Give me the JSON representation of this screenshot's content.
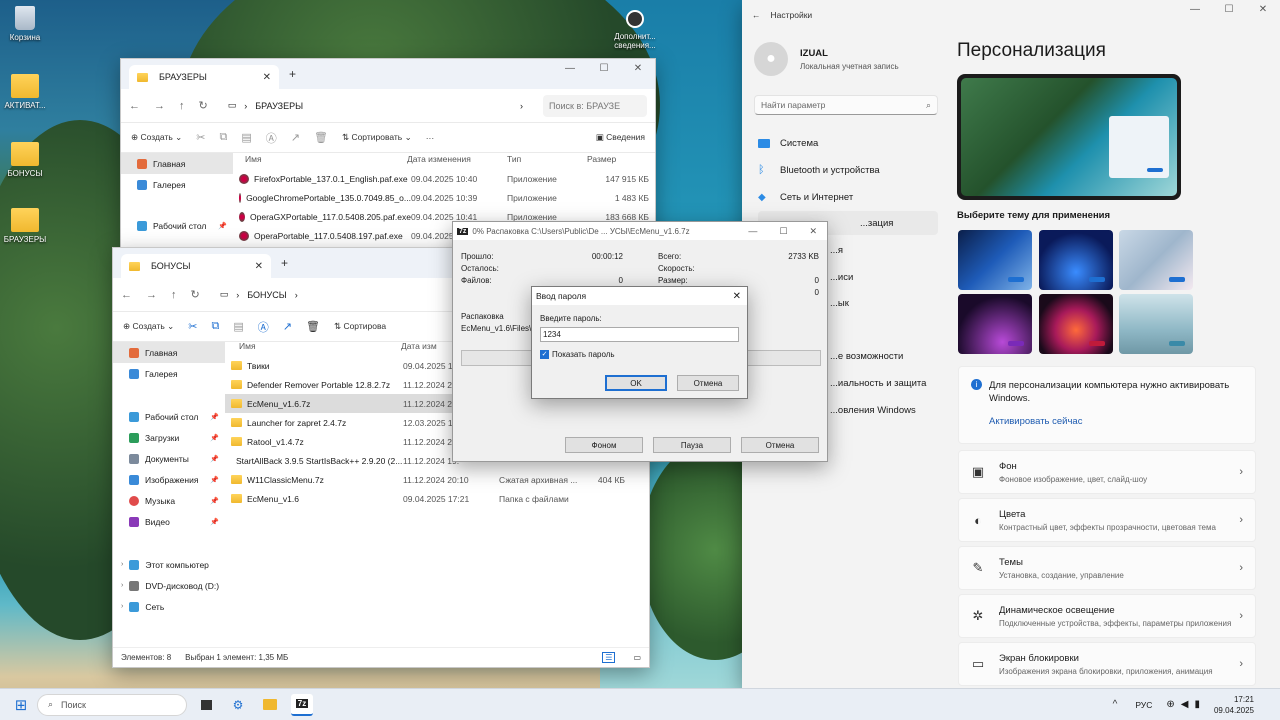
{
  "desktop": {
    "icons": [
      {
        "label": "Корзина"
      },
      {
        "label": "АКТИВАТ..."
      },
      {
        "label": "БОНУСЫ"
      },
      {
        "label": "БРАУЗЕРЫ"
      }
    ],
    "activation_widget": "Дополнит... сведения..."
  },
  "explorer_browsers": {
    "tab_title": "БРАУЗЕРЫ",
    "breadcrumb": "БРАУЗЕРЫ",
    "search_placeholder": "Поиск в: БРАУЗЕ",
    "toolbar": {
      "create": "Создать",
      "sort": "Сортировать",
      "details": "Сведения"
    },
    "nav": [
      {
        "label": "Главная"
      },
      {
        "label": "Галерея"
      },
      {
        "label": "Рабочий стол"
      }
    ],
    "columns": {
      "name": "Имя",
      "date": "Дата изменения",
      "type": "Тип",
      "size": "Размер"
    },
    "rows": [
      {
        "name": "FirefoxPortable_137.0.1_English.paf.exe",
        "date": "09.04.2025 10:40",
        "type": "Приложение",
        "size": "147 915 КБ"
      },
      {
        "name": "GoogleChromePortable_135.0.7049.85_o...",
        "date": "09.04.2025 10:39",
        "type": "Приложение",
        "size": "1 483 КБ"
      },
      {
        "name": "OperaGXPortable_117.0.5408.205.paf.exe",
        "date": "09.04.2025 10:41",
        "type": "Приложение",
        "size": "183 668 КБ"
      },
      {
        "name": "OperaPortable_117.0.5408.197.paf.exe",
        "date": "09.04.2025 10:",
        "type": "Приложение",
        "size": ""
      }
    ]
  },
  "explorer_bonus": {
    "tab_title": "БОНУСЫ",
    "breadcrumb": "БОНУСЫ",
    "toolbar": {
      "create": "Создать",
      "sort": "Сортирова"
    },
    "nav": [
      {
        "label": "Главная"
      },
      {
        "label": "Галерея"
      },
      {
        "label": "Рабочий стол"
      },
      {
        "label": "Загрузки"
      },
      {
        "label": "Документы"
      },
      {
        "label": "Изображения"
      },
      {
        "label": "Музыка"
      },
      {
        "label": "Видео"
      },
      {
        "label": "Этот компьютер"
      },
      {
        "label": "DVD-дисковод (D:)"
      },
      {
        "label": "Сеть"
      }
    ],
    "columns": {
      "name": "Имя",
      "date": "Дата изм"
    },
    "rows": [
      {
        "name": "Твики",
        "date": "09.04.2025 12:",
        "type": "",
        "size": ""
      },
      {
        "name": "Defender Remover Portable 12.8.2.7z",
        "date": "11.12.2024 20:",
        "type": "",
        "size": ""
      },
      {
        "name": "EcMenu_v1.6.7z",
        "date": "11.12.2024 20:",
        "type": "",
        "size": ""
      },
      {
        "name": "Launcher for zapret 2.4.7z",
        "date": "12.03.2025 15:",
        "type": "",
        "size": ""
      },
      {
        "name": "Ratool_v1.4.7z",
        "date": "11.12.2024 20:",
        "type": "",
        "size": ""
      },
      {
        "name": "StartAllBack 3.9.5 StartIsBack++ 2.9.20 (2....",
        "date": "11.12.2024 19:",
        "type": "",
        "size": ""
      },
      {
        "name": "W11ClassicMenu.7z",
        "date": "11.12.2024 20:10",
        "type": "Сжатая архивная ...",
        "size": "404 КБ"
      },
      {
        "name": "EcMenu_v1.6",
        "date": "09.04.2025 17:21",
        "type": "Папка с файлами",
        "size": ""
      }
    ],
    "status_count": "Элементов: 8",
    "status_selected": "Выбран 1 элемент: 1,35 МБ"
  },
  "extract_dialog": {
    "title": "0% Распаковка C:\\Users\\Public\\De ... УСЫ\\EcMenu_v1.6.7z",
    "elapsed_label": "Прошло:",
    "elapsed": "00:00:12",
    "remaining_label": "Осталось:",
    "files_label": "Файлов:",
    "files": "0",
    "total_label": "Всего:",
    "total": "2733 KB",
    "speed_label": "Скорость:",
    "size_label": "Размер:",
    "size": "0",
    "extra": "0",
    "unpack_label": "Распаковка",
    "unpack_path": "EcMenu_v1.6\\Files\\St",
    "btn_background": "Фоном",
    "btn_pause": "Пауза",
    "btn_cancel": "Отмена"
  },
  "password_dialog": {
    "title": "Ввод пароля",
    "prompt": "Введите пароль:",
    "value": "1234",
    "show_password": "Показать пароль",
    "ok": "OK",
    "cancel": "Отмена"
  },
  "settings": {
    "app_title": "Настройки",
    "user_name": "IZUAL",
    "user_type": "Локальная учетная запись",
    "search_placeholder": "Найти параметр",
    "nav": [
      {
        "label": "Система"
      },
      {
        "label": "Bluetooth и устройства"
      },
      {
        "label": "Сеть и Интернет"
      },
      {
        "label": "...зация"
      },
      {
        "label": "...я"
      },
      {
        "label": "...иси"
      },
      {
        "label": "...ык"
      },
      {
        "label": "...е возможности"
      },
      {
        "label": "...иальность и защита"
      },
      {
        "label": "...овления Windows"
      }
    ],
    "page_title": "Персонализация",
    "theme_heading": "Выберите тему для применения",
    "activation_text": "Для персонализации компьютера нужно активировать Windows.",
    "activation_link": "Активировать сейчас",
    "cards": [
      {
        "title": "Фон",
        "subtitle": "Фоновое изображение, цвет, слайд-шоу"
      },
      {
        "title": "Цвета",
        "subtitle": "Контрастный цвет, эффекты прозрачности, цветовая тема"
      },
      {
        "title": "Темы",
        "subtitle": "Установка, создание, управление"
      },
      {
        "title": "Динамическое освещение",
        "subtitle": "Подключенные устройства, эффекты, параметры приложения"
      },
      {
        "title": "Экран блокировки",
        "subtitle": "Изображения экрана блокировки, приложения, анимация"
      }
    ]
  },
  "taskbar": {
    "search": "Поиск",
    "lang": "РУС",
    "time": "17:21",
    "date": "09.04.2025",
    "app_7z": "7z"
  }
}
